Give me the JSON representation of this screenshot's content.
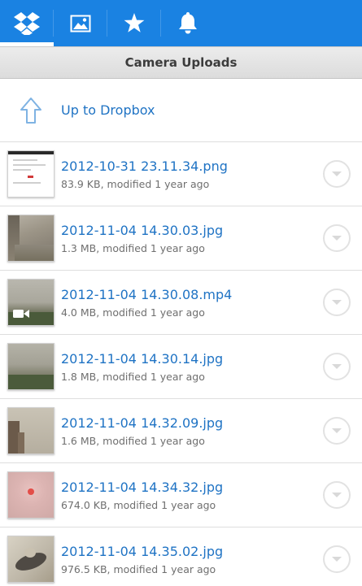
{
  "tabs": [
    {
      "name": "dropbox-icon",
      "active": true
    },
    {
      "name": "photos-icon",
      "active": false
    },
    {
      "name": "star-icon",
      "active": false
    },
    {
      "name": "bell-icon",
      "active": false
    }
  ],
  "folder": {
    "title": "Camera Uploads"
  },
  "up": {
    "label": "Up to Dropbox",
    "icon": "up-arrow-icon"
  },
  "files": [
    {
      "name": "2012-10-31 23.11.34.png",
      "meta": "83.9 KB, modified 1 year ago"
    },
    {
      "name": "2012-11-04 14.30.03.jpg",
      "meta": "1.3 MB, modified 1 year ago"
    },
    {
      "name": "2012-11-04 14.30.08.mp4",
      "meta": "4.0 MB, modified 1 year ago"
    },
    {
      "name": "2012-11-04 14.30.14.jpg",
      "meta": "1.8 MB, modified 1 year ago"
    },
    {
      "name": "2012-11-04 14.32.09.jpg",
      "meta": "1.6 MB, modified 1 year ago"
    },
    {
      "name": "2012-11-04 14.34.32.jpg",
      "meta": "674.0 KB, modified 1 year ago"
    },
    {
      "name": "2012-11-04 14.35.02.jpg",
      "meta": "976.5 KB, modified 1 year ago"
    }
  ],
  "colors": {
    "accent": "#1a82e2",
    "link": "#1f73c4",
    "meta": "#6f6f6f"
  }
}
